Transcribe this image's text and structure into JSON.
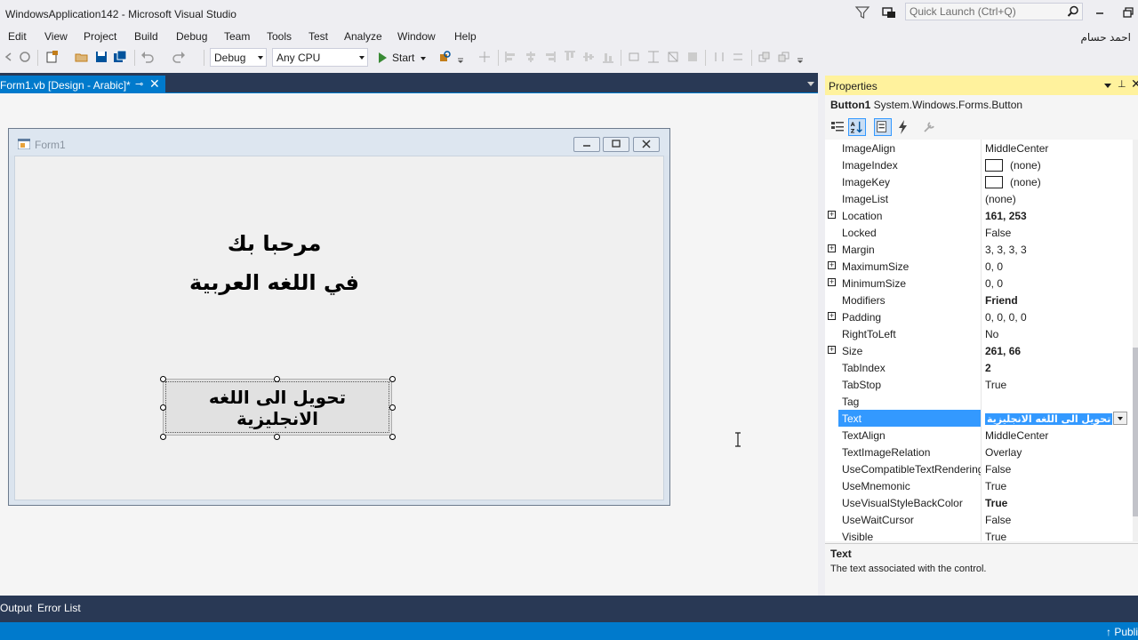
{
  "window": {
    "title": "WindowsApplication142 - Microsoft Visual Studio",
    "quick_launch_placeholder": "Quick Launch (Ctrl+Q)",
    "user_name": "احمد حسام"
  },
  "menu": [
    "Edit",
    "View",
    "Project",
    "Build",
    "Debug",
    "Team",
    "Tools",
    "Test",
    "Analyze",
    "Window",
    "Help"
  ],
  "toolbar": {
    "configuration": "Debug",
    "platform": "Any CPU",
    "start_label": "Start"
  },
  "document": {
    "tab_label": "Form1.vb [Design - Arabic]*"
  },
  "form": {
    "title": "Form1",
    "label_line1": "مرحبا بك",
    "label_line2": "في اللغه العربية",
    "button_line1": "تحويل الى اللغه",
    "button_line2": "الانجليزية"
  },
  "properties": {
    "panel_title": "Properties",
    "object_name": "Button1",
    "object_type": "System.Windows.Forms.Button",
    "rows": [
      {
        "name": "ImageAlign",
        "value": "MiddleCenter",
        "expandable": false,
        "bold": false
      },
      {
        "name": "ImageIndex",
        "value": "(none)",
        "expandable": false,
        "bold": false,
        "swatch": true
      },
      {
        "name": "ImageKey",
        "value": "(none)",
        "expandable": false,
        "bold": false,
        "swatch": true
      },
      {
        "name": "ImageList",
        "value": "(none)",
        "expandable": false,
        "bold": false
      },
      {
        "name": "Location",
        "value": "161, 253",
        "expandable": true,
        "bold": true
      },
      {
        "name": "Locked",
        "value": "False",
        "expandable": false,
        "bold": false
      },
      {
        "name": "Margin",
        "value": "3, 3, 3, 3",
        "expandable": true,
        "bold": false
      },
      {
        "name": "MaximumSize",
        "value": "0, 0",
        "expandable": true,
        "bold": false
      },
      {
        "name": "MinimumSize",
        "value": "0, 0",
        "expandable": true,
        "bold": false
      },
      {
        "name": "Modifiers",
        "value": "Friend",
        "expandable": false,
        "bold": true
      },
      {
        "name": "Padding",
        "value": "0, 0, 0, 0",
        "expandable": true,
        "bold": false
      },
      {
        "name": "RightToLeft",
        "value": "No",
        "expandable": false,
        "bold": false
      },
      {
        "name": "Size",
        "value": "261, 66",
        "expandable": true,
        "bold": true
      },
      {
        "name": "TabIndex",
        "value": "2",
        "expandable": false,
        "bold": true
      },
      {
        "name": "TabStop",
        "value": "True",
        "expandable": false,
        "bold": false
      },
      {
        "name": "Tag",
        "value": "",
        "expandable": false,
        "bold": false
      },
      {
        "name": "Text",
        "value": "تحويل الى اللغه الانجليزية",
        "expandable": false,
        "bold": false,
        "selected": true
      },
      {
        "name": "TextAlign",
        "value": "MiddleCenter",
        "expandable": false,
        "bold": false
      },
      {
        "name": "TextImageRelation",
        "value": "Overlay",
        "expandable": false,
        "bold": false
      },
      {
        "name": "UseCompatibleTextRendering",
        "value": "False",
        "expandable": false,
        "bold": false
      },
      {
        "name": "UseMnemonic",
        "value": "True",
        "expandable": false,
        "bold": false
      },
      {
        "name": "UseVisualStyleBackColor",
        "value": "True",
        "expandable": false,
        "bold": true
      },
      {
        "name": "UseWaitCursor",
        "value": "False",
        "expandable": false,
        "bold": false
      },
      {
        "name": "Visible",
        "value": "True",
        "expandable": false,
        "bold": false
      }
    ],
    "description_title": "Text",
    "description_text": "The text associated with the control."
  },
  "bottom_tabs": [
    "Output",
    "Error List"
  ],
  "status": {
    "publish": "Publi"
  },
  "colors": {
    "accent": "#007acc",
    "dark_chrome": "#293955",
    "properties_header": "#fff29d",
    "selection": "#3399ff"
  }
}
